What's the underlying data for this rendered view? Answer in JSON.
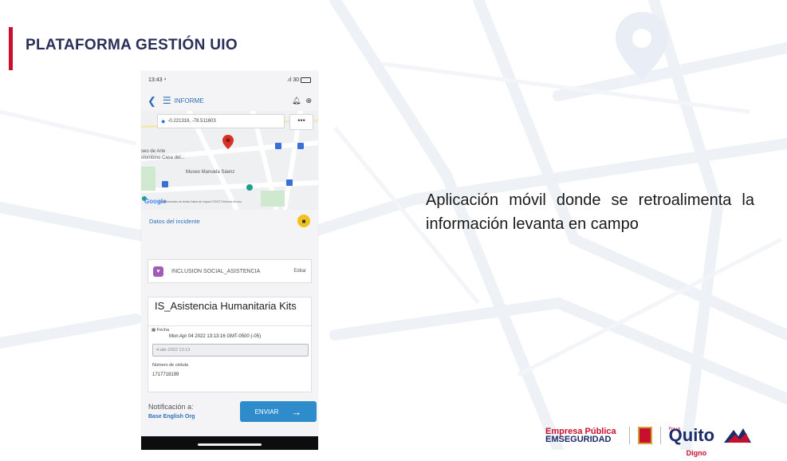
{
  "slide": {
    "title": "PLATAFORMA GESTIÓN UIO",
    "description": "Aplicación móvil donde se retroalimenta la información levanta en campo",
    "accent_color": "#c8102e"
  },
  "phone": {
    "status": {
      "time": "13:43 ⁴",
      "signal": ".ıl 30",
      "battery_icon": "battery-icon"
    },
    "app_bar": {
      "back_icon": "chevron-left-icon",
      "menu_icon": "hamburger-menu-icon",
      "title": "INFORME",
      "icons": [
        "bell-icon",
        "translate-icon"
      ]
    },
    "map": {
      "coordinates": "-0.221316, -78.511603",
      "more_label": "•••",
      "labels": [
        "seo de Arte",
        "olombino Casa del...",
        "Museo Manuela Sáenz"
      ],
      "provider": "Google",
      "footer": "Combinaciones de teclas   Datos de mapas ©2022   Términos de uso"
    },
    "incident": {
      "label": "Datos del incidente",
      "icon": "video-icon"
    },
    "category": {
      "icon": "social-icon",
      "label": "INCLUSIÓN SOCIAL_ASISTENCIA",
      "edit_label": "Editar"
    },
    "report": {
      "title": "IS_Asistencia Humanitaria Kits",
      "fecha_label": "Fecha",
      "fecha_value": "Mon Apr 04 2022 13:13:16 GMT-0500 (-05)",
      "fecha_input": "4-abr-2022 13:13",
      "cedula_label": "Número de cédula",
      "cedula_value": "1717718199"
    },
    "notification": {
      "label": "Notificación a:",
      "org": "Base English Org"
    },
    "send_button": {
      "label": "ENVIAR",
      "arrow": "→",
      "color": "#2f8ccb"
    }
  },
  "logos": {
    "empresa_line1": "Empresa Pública",
    "empresa_line2": "EMSEGURIDAD",
    "quito_small": "Por un",
    "quito": "Quito",
    "digno": "Digno"
  }
}
